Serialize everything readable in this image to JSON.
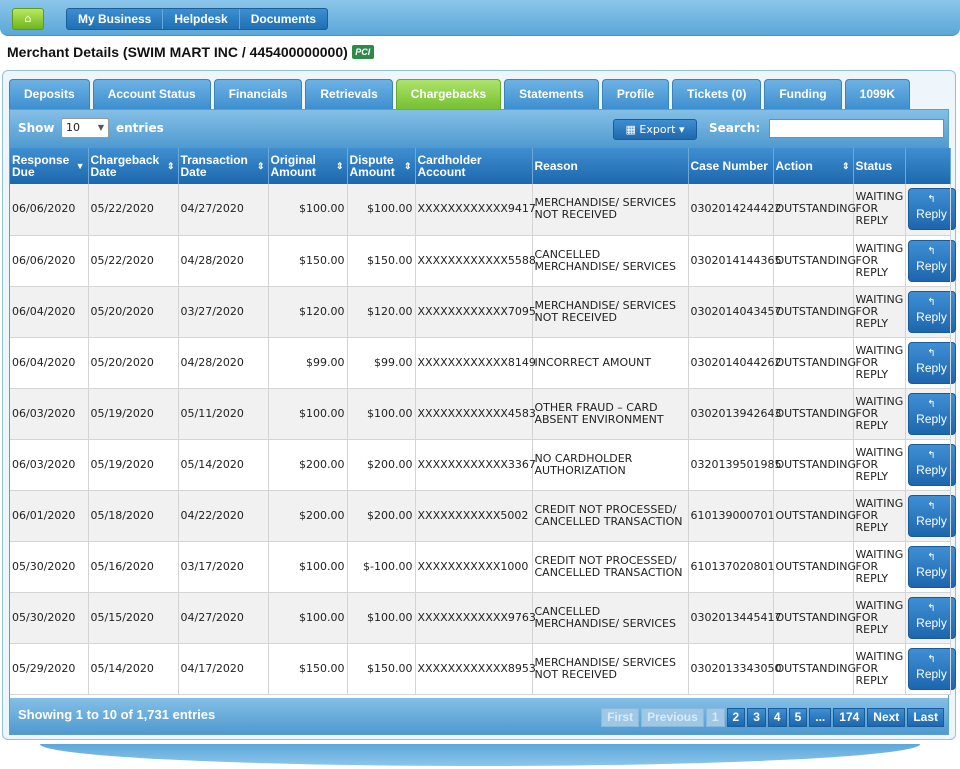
{
  "topnav": {
    "home_icon": "home-icon",
    "links": [
      "My Business",
      "Helpdesk",
      "Documents"
    ]
  },
  "merchant": {
    "title": "Merchant Details (SWIM MART INC /  445400000000)",
    "badge": "PCI"
  },
  "tabs": [
    "Deposits",
    "Account Status",
    "Financials",
    "Retrievals",
    "Chargebacks",
    "Statements",
    "Profile",
    "Tickets (0)",
    "Funding",
    "1099K"
  ],
  "active_tab": "Chargebacks",
  "table_controls": {
    "show_label": "Show",
    "page_size": "10",
    "entries_label": "entries",
    "export_label": "Export",
    "search_label": "Search:",
    "search_value": ""
  },
  "columns": [
    "Response Due",
    "Chargeback Date",
    "Transaction Date",
    "Original Amount",
    "Dispute Amount",
    "Cardholder Account",
    "Reason",
    "Case Number",
    "Action",
    "Status",
    ""
  ],
  "rows": [
    [
      "06/06/2020",
      "05/22/2020",
      "04/27/2020",
      "$100.00",
      "$100.00",
      "XXXXXXXXXXXX9417",
      "MERCHANDISE/ SERVICES NOT RECEIVED",
      "0302014244422",
      "OUTSTANDING",
      "WAITING FOR REPLY"
    ],
    [
      "06/06/2020",
      "05/22/2020",
      "04/28/2020",
      "$150.00",
      "$150.00",
      "XXXXXXXXXXXX5588",
      "CANCELLED MERCHANDISE/ SERVICES",
      "0302014144365",
      "OUTSTANDING",
      "WAITING FOR REPLY"
    ],
    [
      "06/04/2020",
      "05/20/2020",
      "03/27/2020",
      "$120.00",
      "$120.00",
      "XXXXXXXXXXXX7095",
      "MERCHANDISE/ SERVICES NOT RECEIVED",
      "0302014043457",
      "OUTSTANDING",
      "WAITING FOR REPLY"
    ],
    [
      "06/04/2020",
      "05/20/2020",
      "04/28/2020",
      "$99.00",
      "$99.00",
      "XXXXXXXXXXXX8149",
      "INCORRECT AMOUNT",
      "0302014044262",
      "OUTSTANDING",
      "WAITING FOR REPLY"
    ],
    [
      "06/03/2020",
      "05/19/2020",
      "05/11/2020",
      "$100.00",
      "$100.00",
      "XXXXXXXXXXXX4583",
      "OTHER FRAUD – CARD ABSENT ENVIRONMENT",
      "0302013942643",
      "OUTSTANDING",
      "WAITING FOR REPLY"
    ],
    [
      "06/03/2020",
      "05/19/2020",
      "05/14/2020",
      "$200.00",
      "$200.00",
      "XXXXXXXXXXXX3367",
      "NO CARDHOLDER AUTHORIZATION",
      "0320139501985",
      "OUTSTANDING",
      "WAITING FOR REPLY"
    ],
    [
      "06/01/2020",
      "05/18/2020",
      "04/22/2020",
      "$200.00",
      "$200.00",
      "XXXXXXXXXXX5002",
      "CREDIT NOT PROCESSED/ CANCELLED TRANSACTION",
      "610139000701",
      "OUTSTANDING",
      "WAITING FOR REPLY"
    ],
    [
      "05/30/2020",
      "05/16/2020",
      "03/17/2020",
      "$100.00",
      "$-100.00",
      "XXXXXXXXXXX1000",
      "CREDIT NOT PROCESSED/ CANCELLED TRANSACTION",
      "610137020801",
      "OUTSTANDING",
      "WAITING FOR REPLY"
    ],
    [
      "05/30/2020",
      "05/15/2020",
      "04/27/2020",
      "$100.00",
      "$100.00",
      "XXXXXXXXXXXX9763",
      "CANCELLED MERCHANDISE/ SERVICES",
      "0302013445417",
      "OUTSTANDING",
      "WAITING FOR REPLY"
    ],
    [
      "05/29/2020",
      "05/14/2020",
      "04/17/2020",
      "$150.00",
      "$150.00",
      "XXXXXXXXXXXX8953",
      "MERCHANDISE/ SERVICES NOT RECEIVED",
      "0302013343050",
      "OUTSTANDING",
      "WAITING FOR REPLY"
    ]
  ],
  "reply_label": "Reply",
  "footer": {
    "info": "Showing 1 to 10 of 1,731 entries",
    "pager": [
      "First",
      "Previous",
      "1",
      "2",
      "3",
      "4",
      "5",
      "...",
      "174",
      "Next",
      "Last"
    ]
  }
}
